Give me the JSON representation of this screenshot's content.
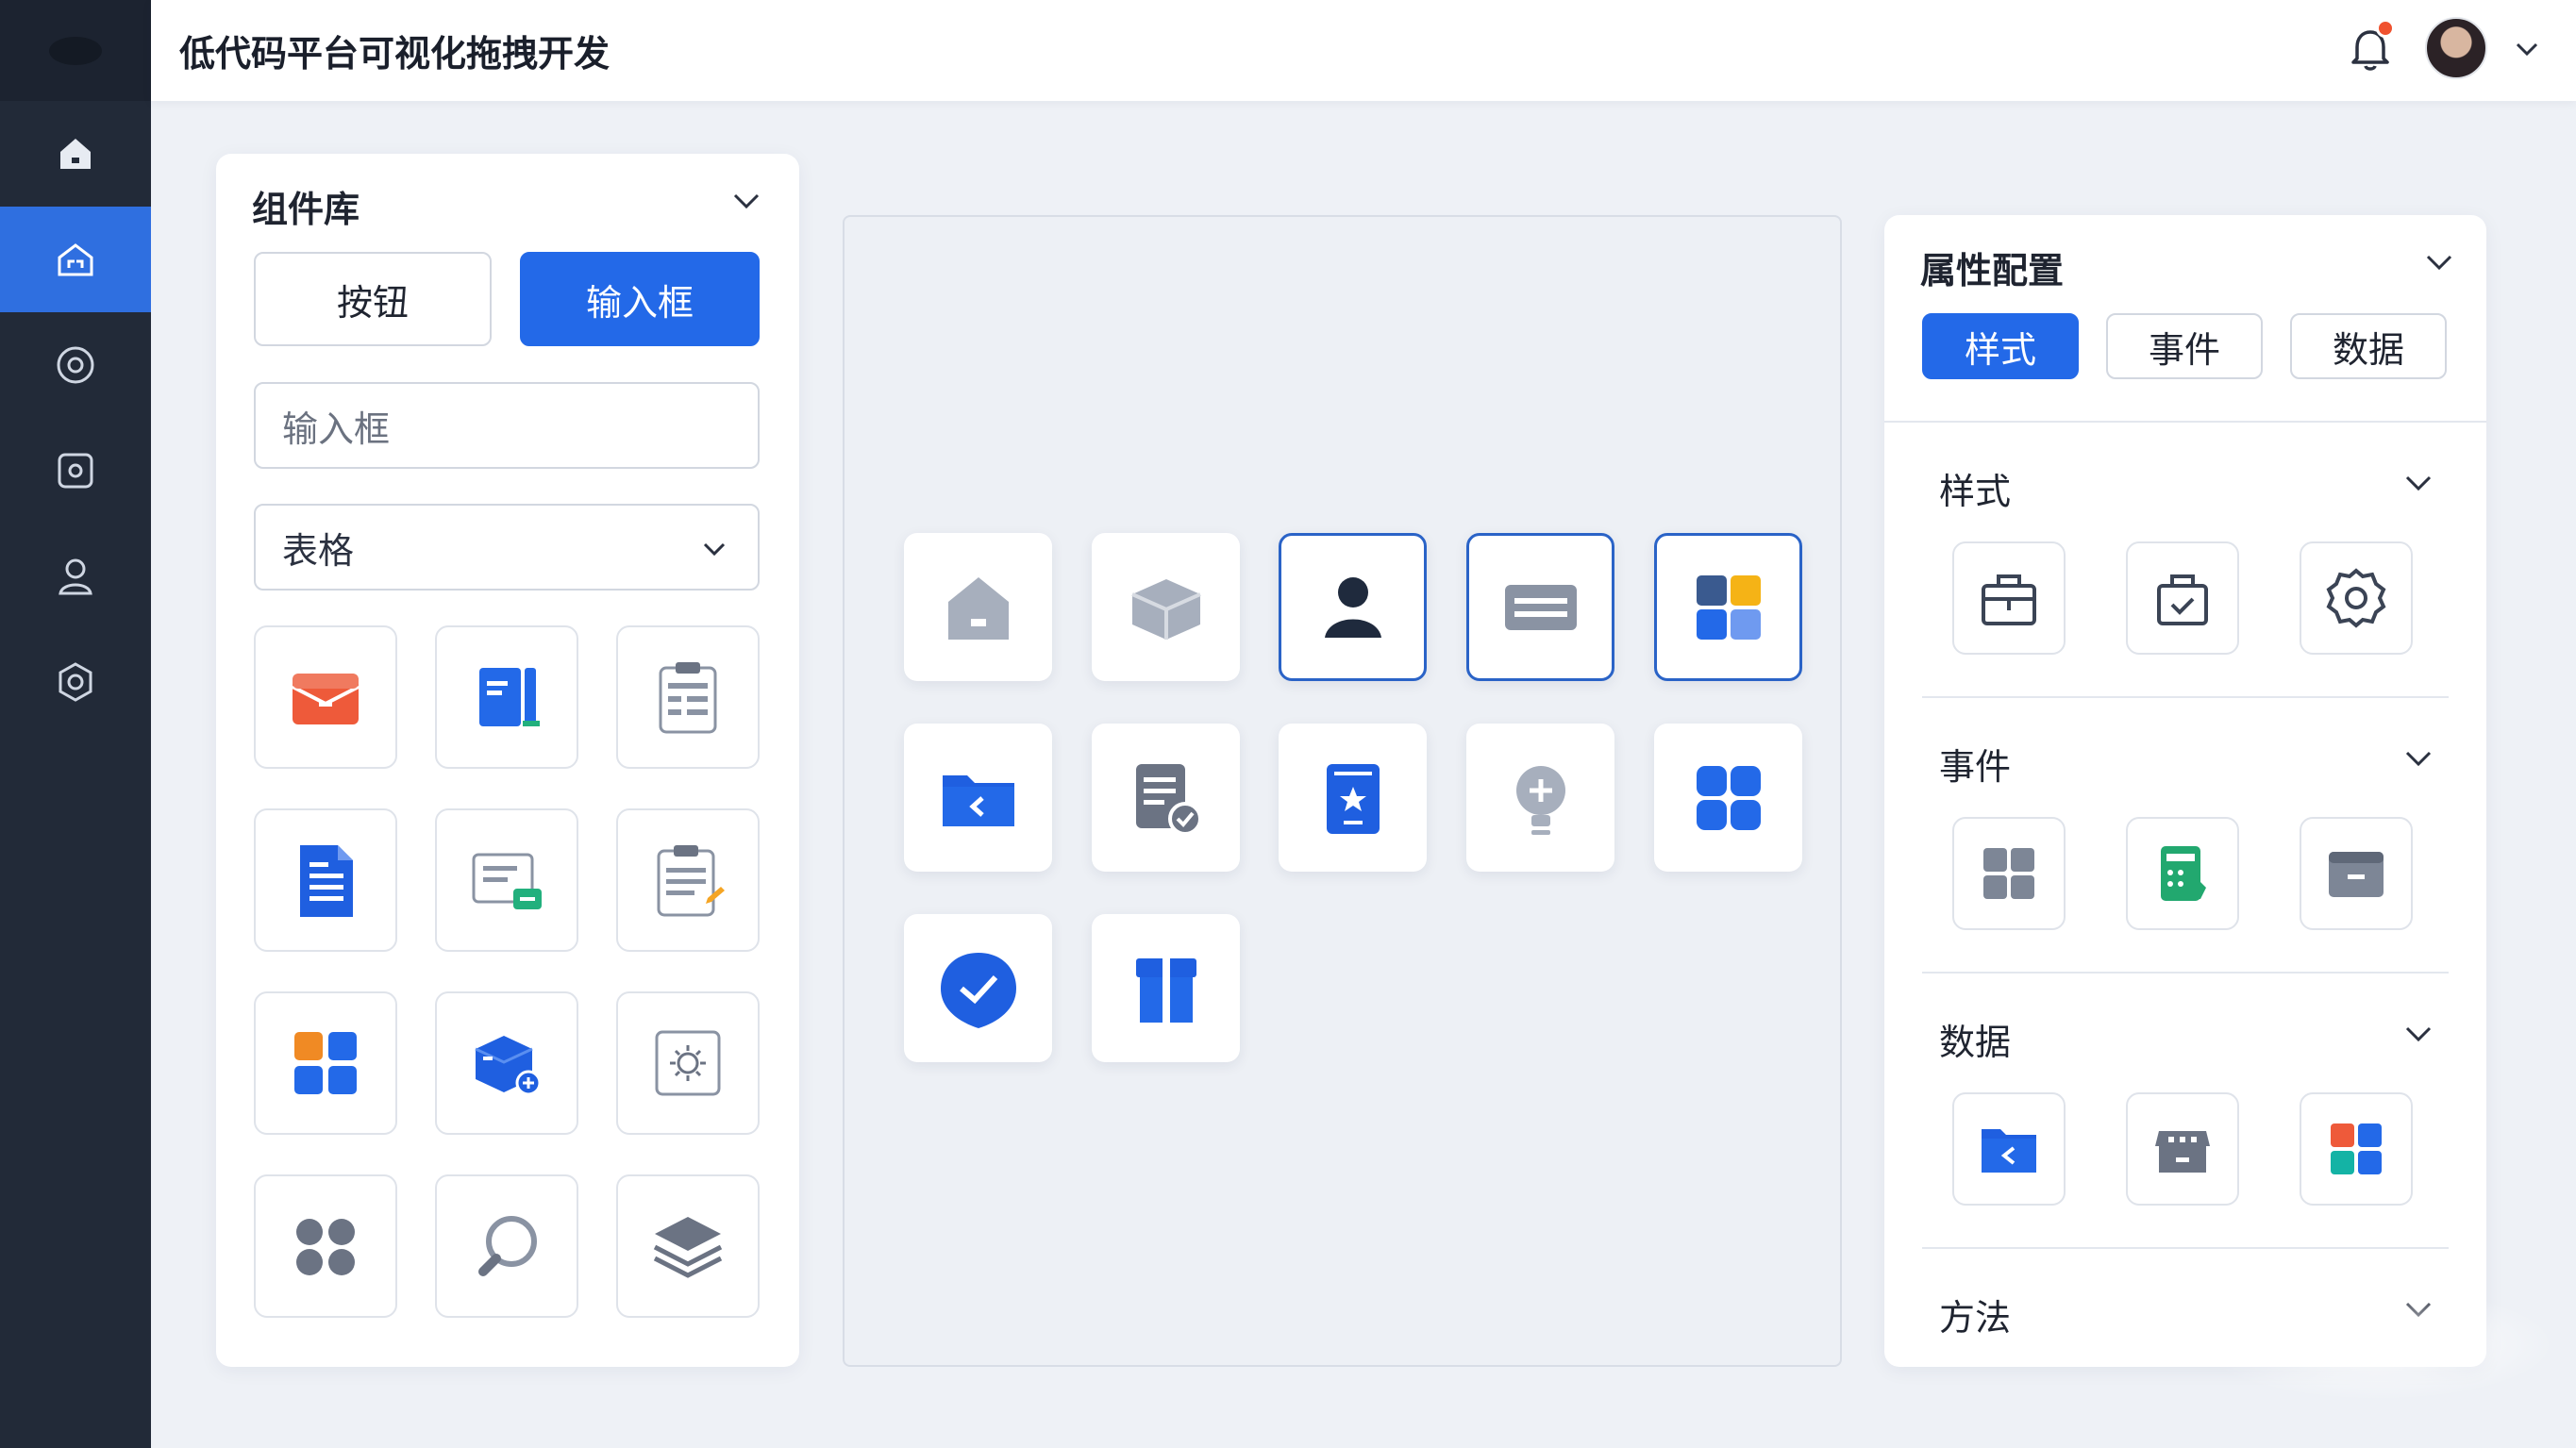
{
  "app": {
    "title": "低代码平台可视化拖拽开发"
  },
  "header": {
    "notification_icon": "bell-icon",
    "has_unread": true,
    "avatar_icon": "user-avatar",
    "menu_icon": "chevron-down-icon"
  },
  "sidebar": {
    "items": [
      {
        "icon": "home-icon",
        "active": false
      },
      {
        "icon": "house-outline-icon",
        "active": true
      },
      {
        "icon": "target-icon",
        "active": false
      },
      {
        "icon": "square-target-icon",
        "active": false
      },
      {
        "icon": "user-icon",
        "active": false
      },
      {
        "icon": "settings-icon",
        "active": false
      }
    ]
  },
  "component_library": {
    "title": "组件库",
    "buttons": {
      "button_label": "按钮",
      "input_label": "输入框"
    },
    "input": {
      "placeholder": "输入框"
    },
    "select": {
      "value": "表格"
    },
    "tiles": [
      "mail-icon",
      "book-icon",
      "clipboard-list-icon",
      "document-icon",
      "message-card-icon",
      "clipboard-edit-icon",
      "grid-color-icon",
      "box-add-icon",
      "settings-frame-icon",
      "dots-grid-icon",
      "search-icon",
      "layers-icon"
    ]
  },
  "canvas": {
    "tiles": [
      {
        "icon": "house-icon",
        "selected": false
      },
      {
        "icon": "package-icon",
        "selected": false
      },
      {
        "icon": "user-icon",
        "selected": true
      },
      {
        "icon": "input-bar-icon",
        "selected": true
      },
      {
        "icon": "grid-color-icon",
        "selected": true
      },
      {
        "icon": "folder-back-icon",
        "selected": false
      },
      {
        "icon": "document-check-icon",
        "selected": false
      },
      {
        "icon": "bookmark-star-icon",
        "selected": false
      },
      {
        "icon": "lightbulb-plus-icon",
        "selected": false
      },
      {
        "icon": "grid-blue-icon",
        "selected": false
      },
      {
        "icon": "shield-check-icon",
        "selected": false
      },
      {
        "icon": "gift-icon",
        "selected": false
      }
    ]
  },
  "properties": {
    "title": "属性配置",
    "tabs": [
      {
        "label": "样式",
        "active": true
      },
      {
        "label": "事件",
        "active": false
      },
      {
        "label": "数据",
        "active": false
      }
    ],
    "sections": [
      {
        "label": "样式",
        "icons": [
          "toolbox-icon",
          "bag-check-icon",
          "gear-icon"
        ]
      },
      {
        "label": "事件",
        "icons": [
          "grid-gray-icon",
          "calculator-icon",
          "drawer-icon"
        ]
      },
      {
        "label": "数据",
        "icons": [
          "folder-back-icon",
          "store-icon",
          "grid-color-icon"
        ]
      },
      {
        "label": "方法",
        "icons": []
      }
    ]
  },
  "colors": {
    "primary": "#2369e8",
    "sidebar": "#222a38",
    "background": "#eef1f6"
  }
}
